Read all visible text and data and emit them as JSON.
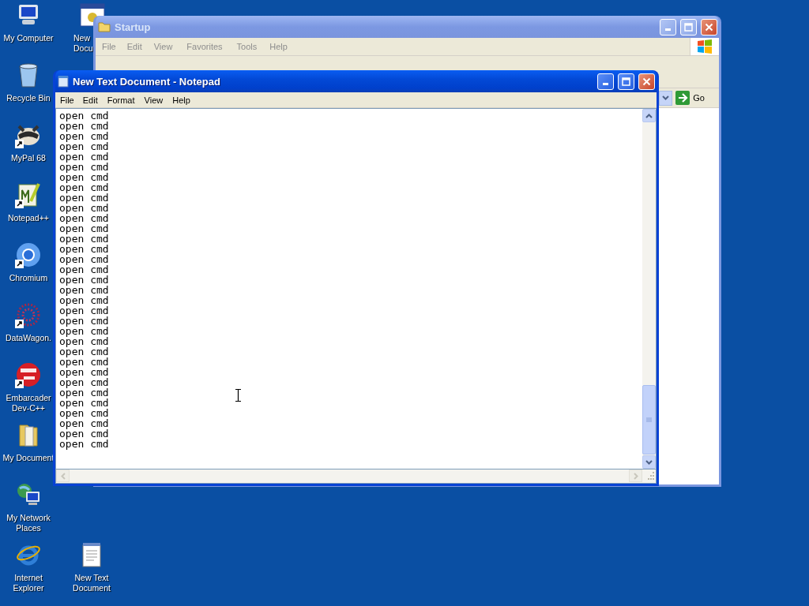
{
  "desktop_icons": [
    {
      "label": "My Computer",
      "shortcut": false
    },
    {
      "label": "Recycle Bin",
      "shortcut": false
    },
    {
      "label": "MyPal 68",
      "shortcut": true
    },
    {
      "label": "Notepad++",
      "shortcut": true
    },
    {
      "label": "Chromium",
      "shortcut": true
    },
    {
      "label": "DataWagon.",
      "shortcut": true
    },
    {
      "label": "Embarcader Dev-C++",
      "shortcut": true
    },
    {
      "label": "My Document",
      "shortcut": false
    },
    {
      "label": "My Network Places",
      "shortcut": false
    },
    {
      "label": "Internet Explorer",
      "shortcut": false
    }
  ],
  "desktop_icons_2": [
    {
      "label": "New Docu",
      "shortcut": false
    },
    {
      "label": "New Text Document",
      "shortcut": false
    }
  ],
  "explorer_window": {
    "title": "Startup",
    "active": false,
    "menu": [
      "File",
      "Edit",
      "View",
      "Favorites",
      "Tools",
      "Help"
    ],
    "go_button": "Go"
  },
  "notepad_window": {
    "title": "New Text Document - Notepad",
    "active": true,
    "menu": [
      "File",
      "Edit",
      "Format",
      "View",
      "Help"
    ],
    "lines": [
      "open cmd",
      "open cmd",
      "open cmd",
      "open cmd",
      "open cmd",
      "open cmd",
      "open cmd",
      "open cmd",
      "open cmd",
      "open cmd",
      "open cmd",
      "open cmd",
      "open cmd",
      "open cmd",
      "open cmd",
      "open cmd",
      "open cmd",
      "open cmd",
      "open cmd",
      "open cmd",
      "open cmd",
      "open cmd",
      "open cmd",
      "open cmd",
      "open cmd",
      "open cmd",
      "open cmd",
      "open cmd",
      "open cmd",
      "open cmd",
      "open cmd",
      "open cmd",
      "open cmd"
    ]
  }
}
